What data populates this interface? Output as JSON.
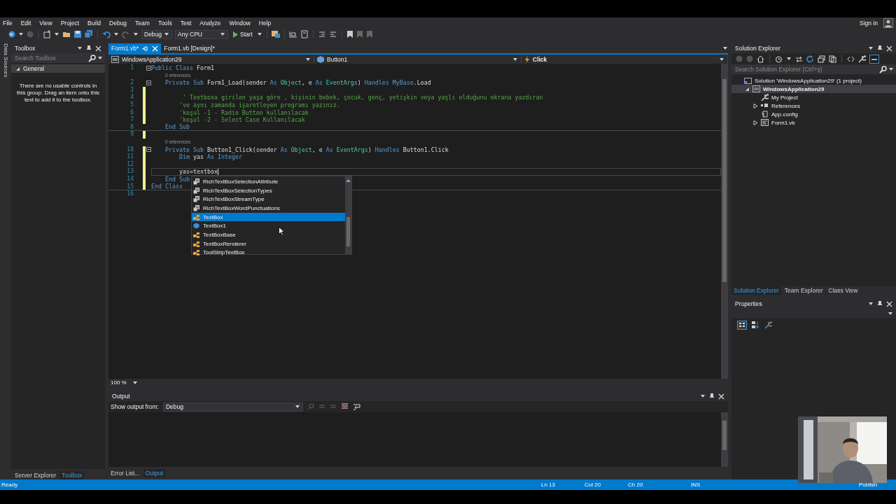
{
  "menu": [
    "File",
    "Edit",
    "View",
    "Project",
    "Build",
    "Debug",
    "Team",
    "Tools",
    "Test",
    "Analyze",
    "Window",
    "Help"
  ],
  "account": {
    "label": "Sign in"
  },
  "toolbar": {
    "configuration": "Debug",
    "platform": "Any CPU",
    "start": "Start"
  },
  "side_strip": {
    "label": "Data Sources"
  },
  "toolbox": {
    "title": "Toolbox",
    "search": {
      "placeholder": "Search Toolbox"
    },
    "group": {
      "label": "General",
      "expanded": true
    },
    "message": "There are no usable controls in this group. Drag an item onto this text to add it to the toolbox."
  },
  "left_tabs": [
    {
      "label": "Server Explorer",
      "selected": false
    },
    {
      "label": "Toolbox",
      "selected": true
    }
  ],
  "editor_tabs": [
    {
      "label": "Form1.vb*",
      "selected": true
    },
    {
      "label": "Form1.vb [Design]*",
      "selected": false
    }
  ],
  "nav_bar": {
    "project": "WindowsApplication29",
    "object": "Button1",
    "event": "Click"
  },
  "code": [
    {
      "kind": "line",
      "number": "1",
      "changed": false,
      "fold": true,
      "current": false,
      "separator": false,
      "tokens": [
        {
          "kind": "keyword",
          "text": "Public Class"
        },
        {
          "kind": "plain",
          "text": " Form1"
        }
      ]
    },
    {
      "kind": "lens",
      "text": "0 references"
    },
    {
      "kind": "line",
      "number": "2",
      "changed": false,
      "fold": true,
      "current": false,
      "separator": false,
      "tokens": [
        {
          "kind": "keyword",
          "text": "    Private Sub"
        },
        {
          "kind": "plain",
          "text": " Form1_Load(sender "
        },
        {
          "kind": "keyword",
          "text": "As"
        },
        {
          "kind": "type",
          "text": " Object"
        },
        {
          "kind": "plain",
          "text": ", e "
        },
        {
          "kind": "keyword",
          "text": "As"
        },
        {
          "kind": "type",
          "text": " EventArgs"
        },
        {
          "kind": "plain",
          "text": ") "
        },
        {
          "kind": "keyword",
          "text": "Handles MyBase"
        },
        {
          "kind": "plain",
          "text": ".Load"
        }
      ]
    },
    {
      "kind": "line",
      "number": "3",
      "changed": true,
      "fold": false,
      "current": false,
      "separator": false
    },
    {
      "kind": "line",
      "number": "4",
      "changed": true,
      "fold": false,
      "current": false,
      "separator": false,
      "tokens": [
        {
          "kind": "comment",
          "text": "         ' Textboxa girilen yaşa göre , kişinin bebek, çocuk, genç, yetişkin veya yaşlı olduğunu ekrana yazdıran"
        }
      ]
    },
    {
      "kind": "line",
      "number": "5",
      "changed": true,
      "fold": false,
      "current": false,
      "separator": false,
      "tokens": [
        {
          "kind": "comment",
          "text": "        've aynı zamanda işaretleyen programı yazınız."
        }
      ]
    },
    {
      "kind": "line",
      "number": "6",
      "changed": true,
      "fold": false,
      "current": false,
      "separator": false,
      "tokens": [
        {
          "kind": "comment",
          "text": "        'koşul -1 - Radio Button kullanılacak"
        }
      ]
    },
    {
      "kind": "line",
      "number": "7",
      "changed": true,
      "fold": false,
      "current": false,
      "separator": false,
      "tokens": [
        {
          "kind": "comment",
          "text": "        'koşul -2 - Select Case Kullanılacak"
        }
      ]
    },
    {
      "kind": "line",
      "number": "8",
      "changed": false,
      "fold": false,
      "current": false,
      "separator": true,
      "tokens": [
        {
          "kind": "keyword",
          "text": "    End Sub"
        }
      ]
    },
    {
      "kind": "line",
      "number": "9",
      "changed": true,
      "fold": false,
      "current": false,
      "separator": false
    },
    {
      "kind": "lens",
      "text": "0 references"
    },
    {
      "kind": "line",
      "number": "10",
      "changed": true,
      "fold": true,
      "current": false,
      "separator": false,
      "tokens": [
        {
          "kind": "keyword",
          "text": "    Private Sub"
        },
        {
          "kind": "plain",
          "text": " Button1_Click(sender "
        },
        {
          "kind": "keyword",
          "text": "As"
        },
        {
          "kind": "type",
          "text": " Object"
        },
        {
          "kind": "plain",
          "text": ", e "
        },
        {
          "kind": "keyword",
          "text": "As"
        },
        {
          "kind": "type",
          "text": " EventArgs"
        },
        {
          "kind": "plain",
          "text": ") "
        },
        {
          "kind": "keyword",
          "text": "Handles"
        },
        {
          "kind": "plain",
          "text": " Button1.Click"
        }
      ]
    },
    {
      "kind": "line",
      "number": "11",
      "changed": true,
      "fold": false,
      "current": false,
      "separator": false,
      "tokens": [
        {
          "kind": "keyword",
          "text": "        Dim"
        },
        {
          "kind": "plain",
          "text": " yas "
        },
        {
          "kind": "keyword",
          "text": "As Integer"
        }
      ]
    },
    {
      "kind": "line",
      "number": "12",
      "changed": true,
      "fold": false,
      "current": false,
      "separator": false
    },
    {
      "kind": "line",
      "number": "13",
      "changed": true,
      "fold": false,
      "current": true,
      "separator": false,
      "tokens": [
        {
          "kind": "plain",
          "text": "        yas="
        },
        {
          "kind": "error",
          "text": "textbox"
        }
      ]
    },
    {
      "kind": "line",
      "number": "14",
      "changed": true,
      "fold": false,
      "current": false,
      "separator": false,
      "tokens": [
        {
          "kind": "keyword",
          "text": "    End Sub"
        }
      ]
    },
    {
      "kind": "line",
      "number": "15",
      "changed": true,
      "fold": false,
      "current": false,
      "separator": true,
      "tokens": [
        {
          "kind": "keyword",
          "text": "End Class"
        }
      ]
    },
    {
      "kind": "line",
      "number": "16",
      "changed": false,
      "fold": false,
      "current": false,
      "separator": false
    }
  ],
  "completion": [
    {
      "label": "RichTextBoxSelectionAttribute",
      "kind": "enum",
      "selected": false
    },
    {
      "label": "RichTextBoxSelectionTypes",
      "kind": "enum",
      "selected": false
    },
    {
      "label": "RichTextBoxStreamType",
      "kind": "enum",
      "selected": false
    },
    {
      "label": "RichTextBoxWordPunctuations",
      "kind": "enum",
      "selected": false
    },
    {
      "label": "TextBox",
      "kind": "class",
      "selected": true
    },
    {
      "label": "TextBox1",
      "kind": "field",
      "selected": false
    },
    {
      "label": "TextBoxBase",
      "kind": "class",
      "selected": false
    },
    {
      "label": "TextBoxRenderer",
      "kind": "class",
      "selected": false
    },
    {
      "label": "ToolStripTextBox",
      "kind": "class",
      "selected": false
    }
  ],
  "zoom": "100 %",
  "output": {
    "title": "Output",
    "source_label": "Show output from:",
    "source": "Debug"
  },
  "bottom_tabs": [
    {
      "label": "Error List...",
      "selected": false
    },
    {
      "label": "Output",
      "selected": true
    }
  ],
  "solution_explorer": {
    "title": "Solution Explorer",
    "search": {
      "placeholder": "Search Solution Explorer (Ctrl+ş)"
    },
    "tree": [
      {
        "label": "Solution 'WindowsApplication29' (1 project)",
        "kind": "solution",
        "selected": false,
        "children": [
          {
            "label": "WindowsApplication29",
            "kind": "project",
            "selected": true,
            "expanded": true,
            "children": [
              {
                "label": "My Project",
                "kind": "properties",
                "selected": false
              },
              {
                "label": "References",
                "kind": "references",
                "selected": false,
                "expanded": false
              },
              {
                "label": "App.config",
                "kind": "config",
                "selected": false
              },
              {
                "label": "Form1.vb",
                "kind": "form",
                "selected": false,
                "expanded": false
              }
            ]
          }
        ]
      }
    ],
    "tabs": [
      {
        "label": "Solution Explorer",
        "selected": true
      },
      {
        "label": "Team Explorer",
        "selected": false
      },
      {
        "label": "Class View",
        "selected": false
      }
    ]
  },
  "properties": {
    "title": "Properties"
  },
  "status_bar": {
    "message": "Ready",
    "line": "Ln 13",
    "column": "Col 20",
    "char": "Ch 20",
    "mode": "INS",
    "publish": "Publish"
  }
}
